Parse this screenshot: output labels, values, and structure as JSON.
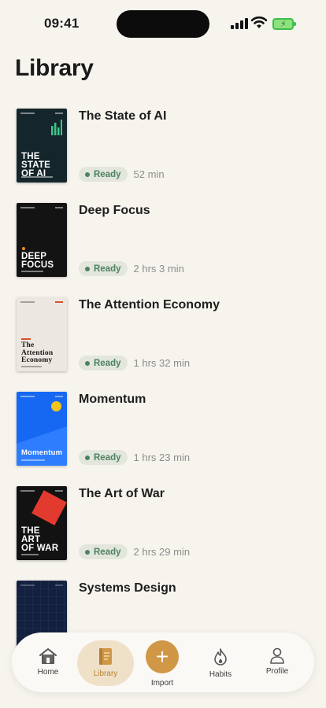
{
  "status": {
    "time": "09:41"
  },
  "page": {
    "title": "Library"
  },
  "books": [
    {
      "title": "The State of AI",
      "status": "Ready",
      "duration": "52 min",
      "cover": {
        "text": [
          "THE",
          "STATE",
          "OF AI"
        ],
        "bg": "#14262b",
        "accent": "#3cc78a"
      }
    },
    {
      "title": "Deep Focus",
      "status": "Ready",
      "duration": "2 hrs 3 min",
      "cover": {
        "text": [
          "DEEP",
          "FOCUS"
        ],
        "bg": "#131313",
        "accent": "#f08a24"
      }
    },
    {
      "title": "The Attention Economy",
      "status": "Ready",
      "duration": "1 hrs 32 min",
      "cover": {
        "text": [
          "The",
          "Attention",
          "Economy"
        ],
        "bg": "#ece8e1",
        "accent": "#d9532c"
      }
    },
    {
      "title": "Momentum",
      "status": "Ready",
      "duration": "1 hrs 23 min",
      "cover": {
        "text": [
          "Momentum"
        ],
        "bg": "#1668f2",
        "accent": "#f2c51d"
      }
    },
    {
      "title": "The Art of War",
      "status": "Ready",
      "duration": "2 hrs 29 min",
      "cover": {
        "text": [
          "THE",
          "ART",
          "OF WAR"
        ],
        "bg": "#121212",
        "accent": "#e23a2f"
      }
    },
    {
      "title": "Systems Design",
      "status": "",
      "duration": "",
      "cover": {
        "text": [],
        "bg": "#13203f",
        "accent": "#2a3c66"
      }
    }
  ],
  "tabs": [
    {
      "label": "Home",
      "icon": "home-icon"
    },
    {
      "label": "Library",
      "icon": "book-icon",
      "active": true
    },
    {
      "label": "Import",
      "icon": "plus-icon"
    },
    {
      "label": "Habits",
      "icon": "flame-icon"
    },
    {
      "label": "Profile",
      "icon": "person-icon"
    }
  ],
  "colors": {
    "accent": "#cf9746",
    "ready_text": "#4d8262",
    "background": "#f7f4ee"
  }
}
